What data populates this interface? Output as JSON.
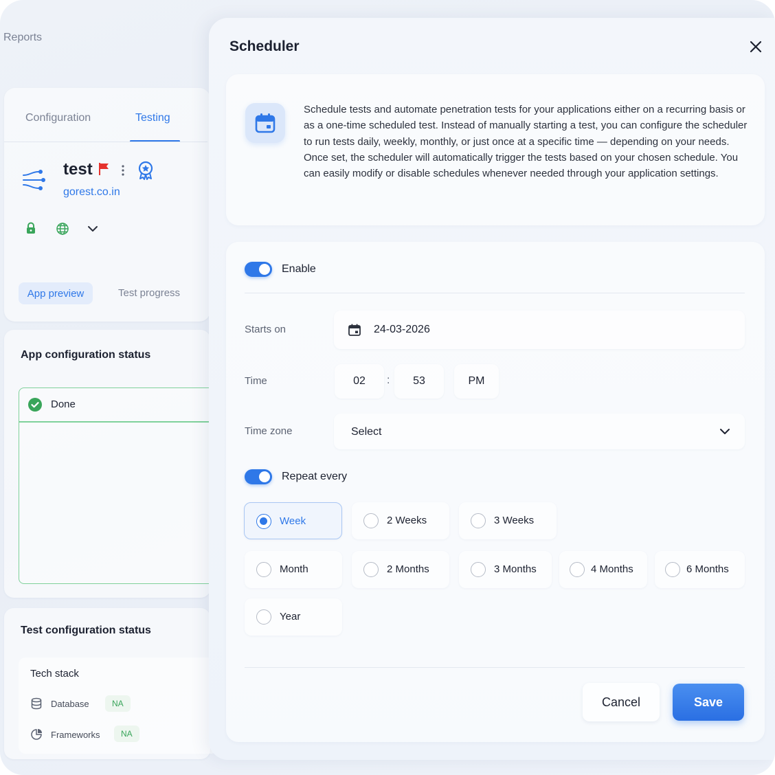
{
  "background": {
    "breadcrumb": "Reports",
    "tabs": [
      {
        "label": "Configuration"
      },
      {
        "label": "Testing"
      }
    ],
    "app": {
      "name": "test",
      "url": "gorest.co.in"
    },
    "subtabs": [
      {
        "label": "App preview"
      },
      {
        "label": "Test progress"
      }
    ],
    "app_config": {
      "title": "App configuration status",
      "status": "Done"
    },
    "test_config": {
      "title": "Test configuration status",
      "tech_stack_title": "Tech stack",
      "rows": [
        {
          "label": "Database",
          "value": "NA"
        },
        {
          "label": "Frameworks",
          "value": "NA"
        }
      ]
    }
  },
  "scheduler": {
    "title": "Scheduler",
    "description": "Schedule tests and automate penetration tests for your applications either on a recurring basis or as a one-time scheduled test. Instead of manually starting a test, you can configure the scheduler to run tests daily, weekly, monthly, or just once at a specific time — depending on your needs. Once set, the scheduler will automatically trigger the tests based on your chosen schedule. You can easily modify or disable schedules whenever needed through your application settings.",
    "enable_label": "Enable",
    "enabled": true,
    "starts_on_label": "Starts on",
    "starts_on_value": "24-03-2026",
    "time_label": "Time",
    "time_hour": "02",
    "time_separator": ":",
    "time_minute": "53",
    "time_period": "PM",
    "timezone_label": "Time zone",
    "timezone_value": "Select",
    "repeat_label": "Repeat every",
    "repeat_enabled": true,
    "repeat_options": [
      {
        "label": "Week",
        "selected": true
      },
      {
        "label": "2 Weeks",
        "selected": false
      },
      {
        "label": "3 Weeks",
        "selected": false
      },
      {
        "label": "Month",
        "selected": false
      },
      {
        "label": "2 Months",
        "selected": false
      },
      {
        "label": "3 Months",
        "selected": false
      },
      {
        "label": "4 Months",
        "selected": false
      },
      {
        "label": "6 Months",
        "selected": false
      },
      {
        "label": "Year",
        "selected": false
      }
    ],
    "cancel_label": "Cancel",
    "save_label": "Save"
  },
  "colors": {
    "accent": "#2f78e8",
    "success": "#39a55a",
    "flag": "#e5322d",
    "text": "#1c2130",
    "muted": "#7b8294"
  },
  "icons": [
    "close-icon",
    "calendar-icon",
    "flag-icon",
    "kebab-icon",
    "badge-icon",
    "lock-icon",
    "globe-icon",
    "chevron-down-icon",
    "check-circle-icon",
    "database-icon",
    "frameworks-icon",
    "app-flow-icon"
  ]
}
